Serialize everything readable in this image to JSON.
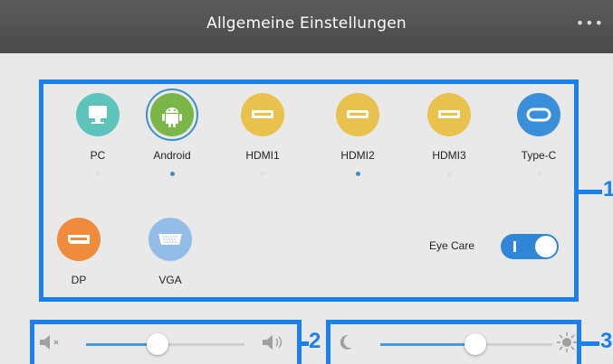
{
  "window": {
    "title": "Allgemeine Einstellungen",
    "more_label": "•••"
  },
  "sources": [
    {
      "label": "PC",
      "icon": "monitor-icon",
      "color": "#5cc4bb",
      "selected": false,
      "active": false
    },
    {
      "label": "Android",
      "icon": "android-icon",
      "color": "#7ab648",
      "selected": true,
      "active": true
    },
    {
      "label": "HDMI1",
      "icon": "hdmi-port-icon",
      "color": "#e8c24d",
      "selected": false,
      "active": false
    },
    {
      "label": "HDMI2",
      "icon": "hdmi-port-icon",
      "color": "#e8c24d",
      "selected": false,
      "active": true
    },
    {
      "label": "HDMI3",
      "icon": "hdmi-port-icon",
      "color": "#e8c24d",
      "selected": false,
      "active": false
    },
    {
      "label": "Type-C",
      "icon": "usb-c-icon",
      "color": "#3a8fdb",
      "selected": false,
      "active": false
    },
    {
      "label": "DP",
      "icon": "displayport-icon",
      "color": "#ef8b3a",
      "selected": false,
      "active": false
    },
    {
      "label": "VGA",
      "icon": "vga-icon",
      "color": "#93bde8",
      "selected": false,
      "active": false
    }
  ],
  "eye_care": {
    "label": "Eye Care",
    "enabled": true
  },
  "volume": {
    "level": 0.35,
    "min_icon": "speaker-mute-icon",
    "max_icon": "speaker-loud-icon"
  },
  "brightness": {
    "level": 0.6,
    "min_icon": "moon-icon",
    "max_icon": "sun-icon"
  },
  "callouts": [
    "1",
    "2",
    "3"
  ],
  "colors": {
    "accent": "#3a8fd0",
    "callout": "#1a7ff0"
  }
}
